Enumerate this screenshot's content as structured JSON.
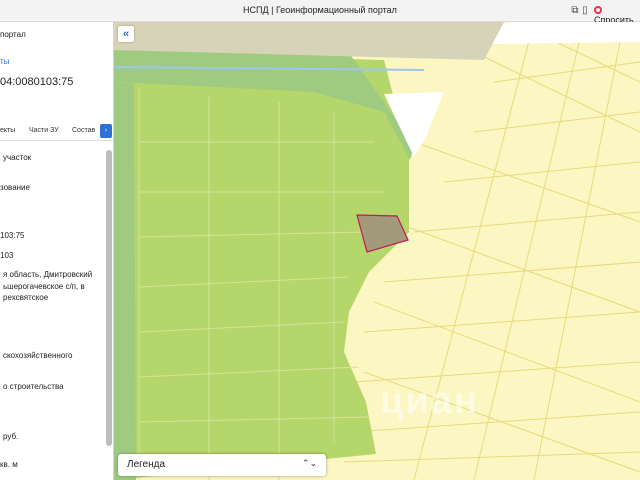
{
  "window": {
    "title": "НСПД | Геоинформационный портал",
    "ask_label": "Спросить"
  },
  "sidebar": {
    "portal_label": "портал",
    "section_label": "ты",
    "cadastral_number": "04:0080103:75",
    "tabs": [
      "екты",
      "Части ЗУ",
      "Состав"
    ],
    "rows": [
      "участок",
      "зование",
      "103:75",
      "103",
      "я область, Дмитровский",
      "ьшерогачевское с/п, в",
      "рехсвятское",
      "скохозяйственного",
      "о строительства",
      "руб.",
      "кв. м"
    ]
  },
  "map": {
    "legend_label": "Легенда",
    "watermark": "циан",
    "colors": {
      "green_zone": "#b4d66a",
      "dark_green_zone": "#9fcb80",
      "yellow_zone": "#fbf6c2",
      "parcel_outline": "#c2185b",
      "selected_fill": "#a39a7a"
    }
  }
}
